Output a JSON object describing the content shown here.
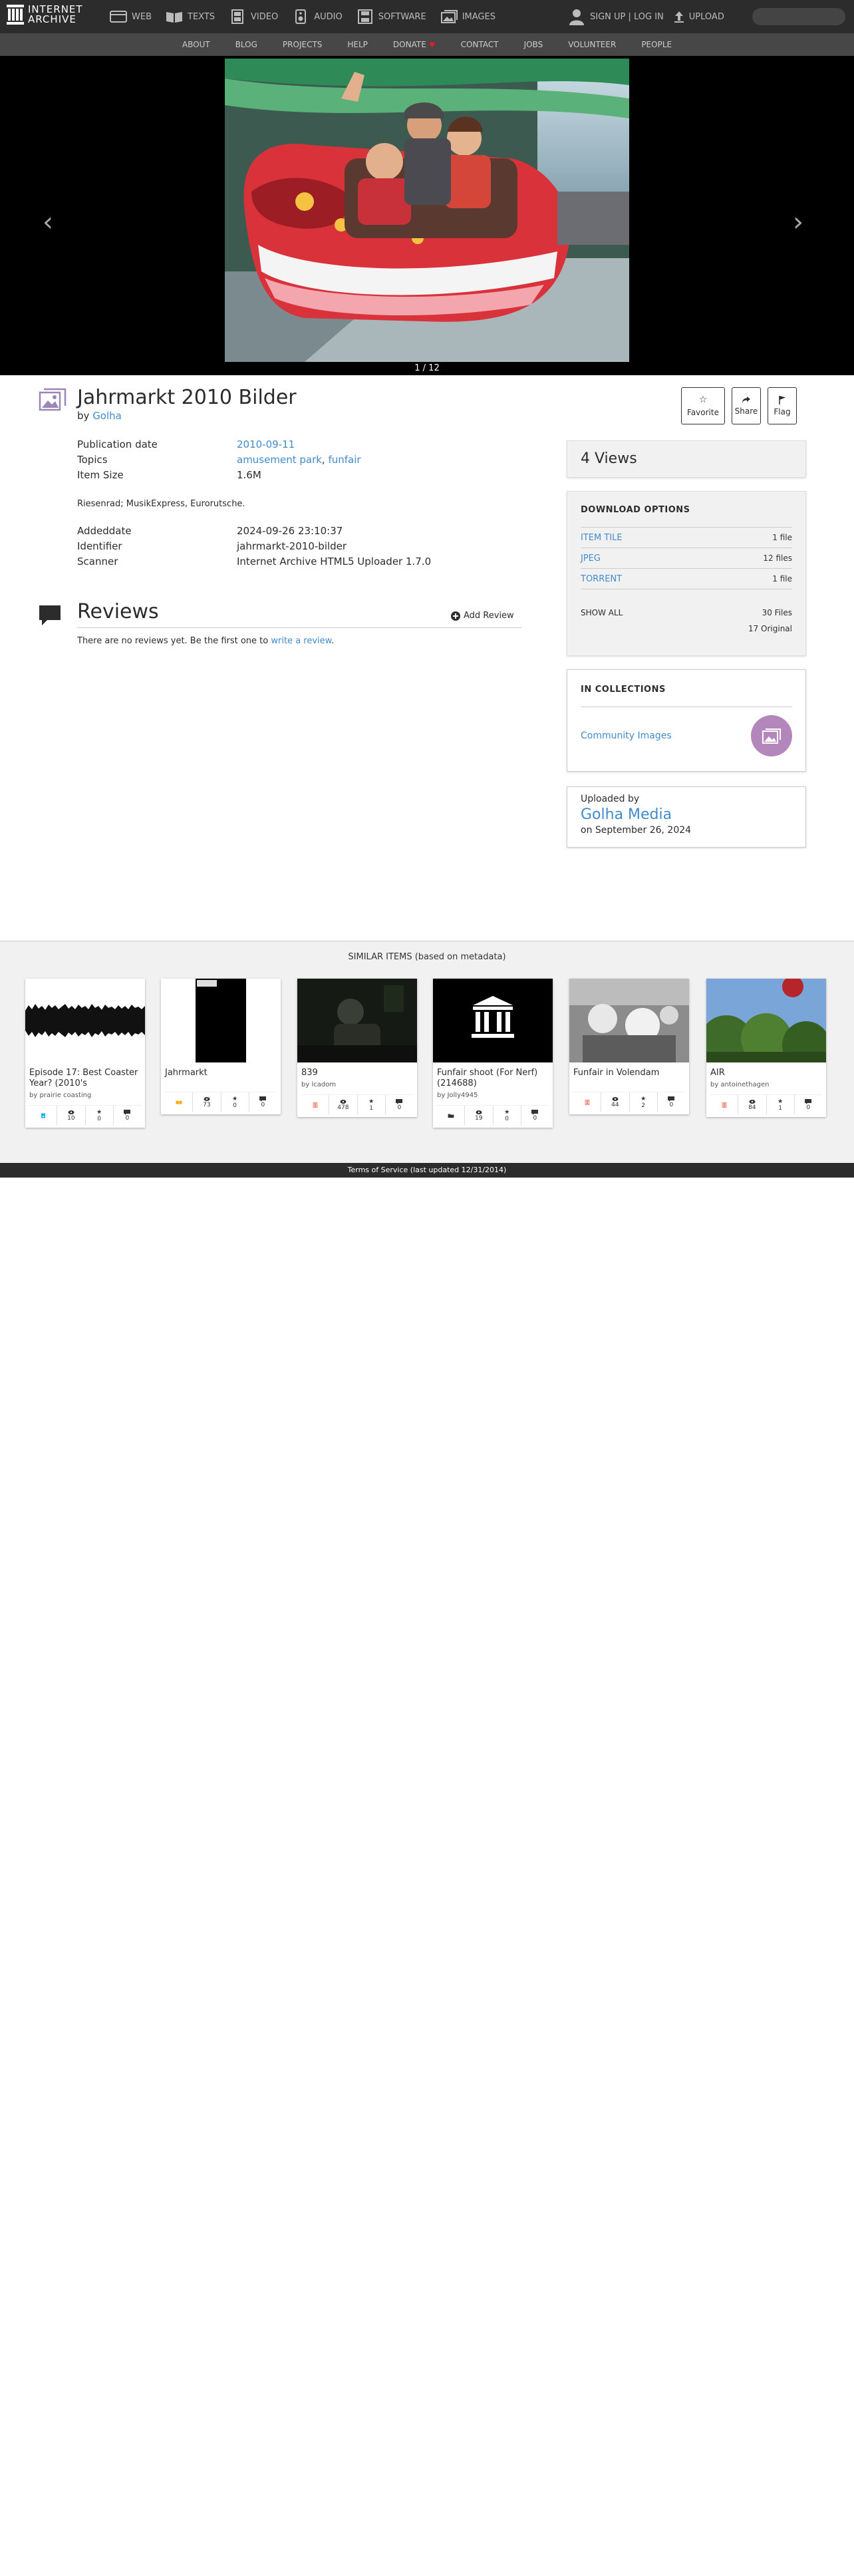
{
  "header": {
    "logo_line1": "INTERNET",
    "logo_line2": "ARCHIVE",
    "mediatypes": [
      "WEB",
      "TEXTS",
      "VIDEO",
      "AUDIO",
      "SOFTWARE",
      "IMAGES"
    ],
    "auth": "SIGN UP | LOG IN",
    "upload": "UPLOAD"
  },
  "subnav": [
    "ABOUT",
    "BLOG",
    "PROJECTS",
    "HELP",
    "DONATE",
    "CONTACT",
    "JOBS",
    "VOLUNTEER",
    "PEOPLE"
  ],
  "theatre": {
    "page_count": "1 / 12"
  },
  "item": {
    "title": "Jahrmarkt 2010 Bilder",
    "by": "by",
    "creator": "Golha",
    "actions": {
      "favorite": "Favorite",
      "share": "Share",
      "flag": "Flag"
    },
    "meta": {
      "pubdate_key": "Publication date",
      "pubdate_val": "2010-09-11",
      "topics_key": "Topics",
      "topic1": "amusement park",
      "topic_sep": ",",
      "topic2": "funfair",
      "size_key": "Item Size",
      "size_val": "1.6M",
      "description": "Riesenrad; MusikExpress, Eurorutsche.",
      "added_key": "Addeddate",
      "added_val": "2024-09-26 23:10:37",
      "ident_key": "Identifier",
      "ident_val": "jahrmarkt-2010-bilder",
      "scanner_key": "Scanner",
      "scanner_val": "Internet Archive HTML5 Uploader 1.7.0"
    }
  },
  "reviews": {
    "title": "Reviews",
    "add": "Add Review",
    "none_text": "There are no reviews yet. Be the first one to",
    "link": "write a review",
    "dot": "."
  },
  "sidebar": {
    "views": "4 Views",
    "download": {
      "heading": "DOWNLOAD OPTIONS",
      "rows": [
        {
          "label": "ITEM TILE",
          "count": "1 file"
        },
        {
          "label": "JPEG",
          "count": "12 files"
        },
        {
          "label": "TORRENT",
          "count": "1 file"
        }
      ],
      "show_all": "SHOW ALL",
      "total": "30 Files",
      "original": "17 Original"
    },
    "collections": {
      "heading": "IN COLLECTIONS",
      "item": "Community Images"
    },
    "uploaded": {
      "label": "Uploaded by",
      "name": "Golha Media",
      "date": "on September 26, 2024"
    }
  },
  "similar": {
    "title": "SIMILAR ITEMS (based on metadata)",
    "tiles": [
      {
        "title": "Episode 17: Best Coaster Year? (2010's",
        "by": "by prairie coasting",
        "views": "10",
        "favs": "0",
        "reviews": "0"
      },
      {
        "title": "Jahrmarkt",
        "by": "",
        "views": "73",
        "favs": "0",
        "reviews": "0"
      },
      {
        "title": "839",
        "by": "by lcadom",
        "views": "478",
        "favs": "1",
        "reviews": "0"
      },
      {
        "title": "Funfair shoot (For Nerf) (214688)",
        "by": "by Jolly4945",
        "views": "19",
        "favs": "0",
        "reviews": "0"
      },
      {
        "title": "Funfair in Volendam",
        "by": "",
        "views": "44",
        "favs": "2",
        "reviews": "0"
      },
      {
        "title": "AIR",
        "by": "by antoinethagen",
        "views": "84",
        "favs": "1",
        "reviews": "0"
      }
    ]
  },
  "footer": "Terms of Service (last updated 12/31/2014)"
}
